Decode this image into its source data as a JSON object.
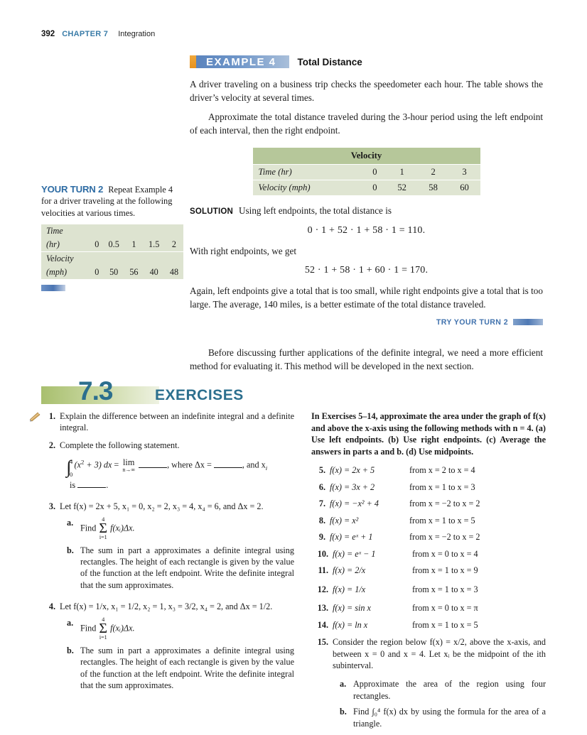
{
  "running_head": {
    "page_number": "392",
    "chapter": "CHAPTER 7",
    "chapter_title": "Integration"
  },
  "example": {
    "badge": "EXAMPLE  4",
    "title": "Total Distance",
    "paragraph1": "A driver traveling on a business trip checks the speedometer each hour. The table shows the driver’s velocity at several times.",
    "paragraph2": "Approximate the total distance traveled during the 3-hour period using the left endpoint of each interval, then the right endpoint.",
    "table": {
      "caption": "Velocity",
      "rows": [
        {
          "label": "Time (hr)",
          "values": [
            "0",
            "1",
            "2",
            "3"
          ]
        },
        {
          "label": "Velocity (mph)",
          "values": [
            "0",
            "52",
            "58",
            "60"
          ]
        }
      ]
    },
    "solution_label": "SOLUTION",
    "solution_intro": "Using left endpoints, the total distance is",
    "equation_left": "0 · 1 + 52 · 1 + 58 · 1 = 110.",
    "right_intro": "With right endpoints, we get",
    "equation_right": "52 · 1 + 58 · 1 + 60 · 1 = 170.",
    "conclusion": "Again, left endpoints give a total that is too small, while right endpoints give a total that is too large. The average, 140 miles, is a better estimate of the total distance traveled.",
    "try_turn_label": "TRY YOUR TURN 2",
    "closing_paragraph": "Before discussing further applications of the definite integral, we need a more efficient method for evaluating it. This method will be developed in the next section."
  },
  "your_turn": {
    "heading": "YOUR TURN 2",
    "lead": "Repeat",
    "text": "Example 4 for a driver traveling at the following velocities at various times.",
    "table": {
      "rows": [
        {
          "label_top": "Time",
          "label_bottom": "(hr)",
          "values": [
            "0",
            "0.5",
            "1",
            "1.5",
            "2"
          ]
        },
        {
          "label_top": "Velocity",
          "label_bottom": "(mph)",
          "values": [
            "0",
            "50",
            "56",
            "40",
            "48"
          ]
        }
      ]
    }
  },
  "exercises_header": {
    "section_number": "7.3",
    "word": "EXERCISES"
  },
  "exercises_left": [
    {
      "number": "1.",
      "text": "Explain the difference between an indefinite integral and a definite integral."
    },
    {
      "number": "2.",
      "text": "Complete the following statement.",
      "equation_parts": {
        "int_upper": "4",
        "int_lower": "0",
        "integrand": "(x",
        "integrand_sup": "2",
        "integrand_rest": " + 3) dx",
        "equals": "=",
        "lim_word": "lim",
        "lim_sub": "n→∞",
        "where": ", where Δx =",
        "and": ", and x",
        "and_sub": "i",
        "is_line": "is"
      }
    },
    {
      "number": "3.",
      "text": "Let f(x) = 2x + 5, x₁ = 0, x₂ = 2, x₃ = 4, x₄ = 6, and Δx = 2.",
      "sub": [
        {
          "letter": "a.",
          "text": "Find"
        },
        {
          "letter": "b.",
          "text": "The sum in part a approximates a definite integral using rectangles. The height of each rectangle is given by the value of the function at the left endpoint. Write the definite integral that the sum approximates."
        }
      ],
      "sum_expr": {
        "top": "4",
        "sigma": "Σ",
        "bottom": "i=1",
        "body": "f(xᵢ)Δx."
      }
    },
    {
      "number": "4.",
      "text": "Let f(x) = 1/x, x₁ = 1/2, x₂ = 1, x₃ = 3/2, x₄ = 2, and Δx = 1/2.",
      "sub": [
        {
          "letter": "a.",
          "text": "Find"
        },
        {
          "letter": "b.",
          "text": "The sum in part a approximates a definite integral using rectangles. The height of each rectangle is given by the value of the function at the left endpoint. Write the definite integral that the sum approximates."
        }
      ],
      "sum_expr": {
        "top": "4",
        "sigma": "Σ",
        "bottom": "i=1",
        "body": "f(xᵢ)Δx."
      }
    }
  ],
  "exercises_right": {
    "instructions": "In Exercises 5–14, approximate the area under the graph of f(x) and above the x-axis using the following methods with n = 4. (a) Use left endpoints. (b) Use right endpoints. (c) Average the answers in parts a and b. (d) Use midpoints.",
    "items": [
      {
        "number": "5.",
        "function": "f(x) = 2x + 5",
        "range": "from x = 2 to x = 4"
      },
      {
        "number": "6.",
        "function": "f(x) = 3x + 2",
        "range": "from x = 1 to x = 3"
      },
      {
        "number": "7.",
        "function": "f(x) = −x² + 4",
        "range": "from x = −2 to x = 2"
      },
      {
        "number": "8.",
        "function": "f(x) = x²",
        "range": "from x = 1 to x = 5"
      },
      {
        "number": "9.",
        "function": "f(x) = eˣ + 1",
        "range": "from x = −2 to x = 2"
      },
      {
        "number": "10.",
        "function": "f(x) = eˣ − 1",
        "range": "from x = 0 to x = 4"
      },
      {
        "number": "11.",
        "function": "f(x) = 2/x",
        "range": "from x = 1 to x = 9"
      },
      {
        "number": "12.",
        "function": "f(x) = 1/x",
        "range": "from x = 1 to x = 3"
      },
      {
        "number": "13.",
        "function": "f(x) = sin x",
        "range": "from x = 0 to x = π"
      },
      {
        "number": "14.",
        "function": "f(x) = ln x",
        "range": "from x = 1 to x = 5"
      }
    ],
    "item15": {
      "number": "15.",
      "text": "Consider the region below f(x) = x/2, above the x-axis, and between x = 0 and x = 4. Let xᵢ be the midpoint of the ith subinterval.",
      "sub": [
        {
          "letter": "a.",
          "text": "Approximate the area of the region using four rectangles."
        },
        {
          "letter": "b.",
          "text": "Find ∫₀⁴ f(x) dx by using the formula for the area of a triangle."
        }
      ]
    }
  },
  "colors": {
    "chapter_blue": "#3a7ca8",
    "example_blue": "#5b84bd",
    "example_orange": "#e6921f",
    "table_header_green": "#b6c79a",
    "table_body_green": "#dfe5d2",
    "section_teal": "#2c6f8e",
    "section_green": "#a8bf6e"
  }
}
